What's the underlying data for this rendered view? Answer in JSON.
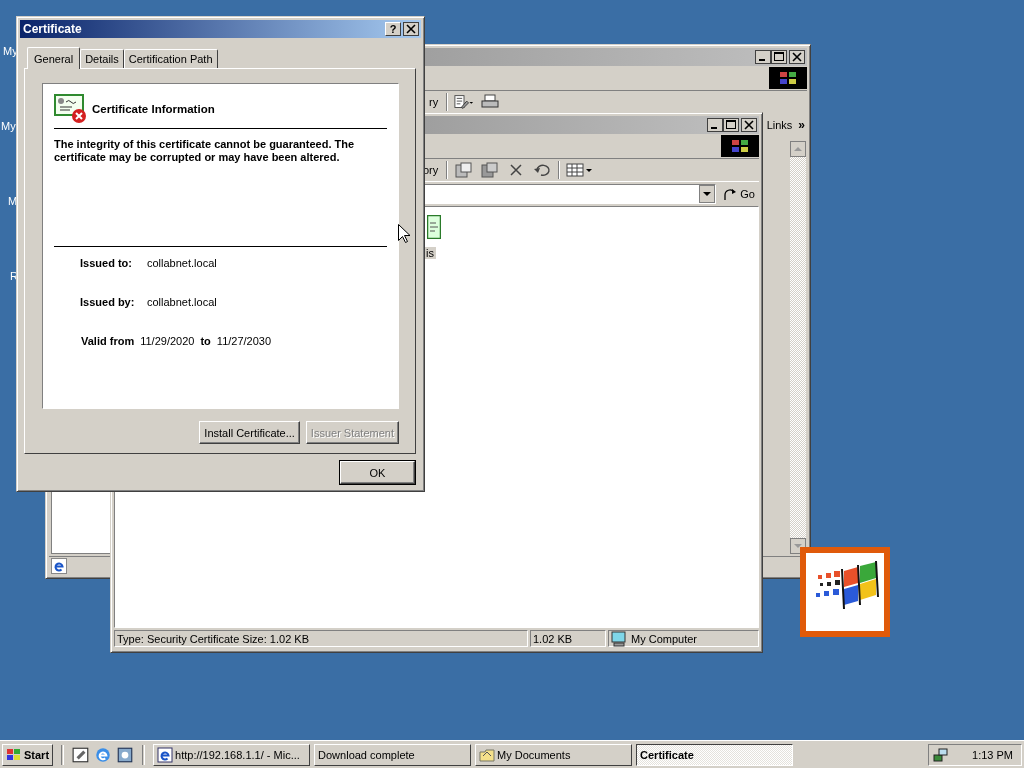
{
  "desktop": {
    "icons": [
      {
        "label": "My"
      },
      {
        "label": "My"
      },
      {
        "label": "M"
      },
      {
        "label": "R"
      }
    ]
  },
  "back_window": {
    "toolbar_fragment": "ry",
    "links": "Links",
    "chevron": "»"
  },
  "explorer_window": {
    "toolbar_fragment": "ory",
    "go": "Go",
    "file_label": "is",
    "status_bar": [
      "Type: Security Certificate Size: 1.02 KB",
      "1.02 KB",
      "My Computer"
    ]
  },
  "dialog": {
    "title": "Certificate",
    "help": "?",
    "tabs": [
      {
        "label": "General",
        "selected": true
      },
      {
        "label": "Details",
        "selected": false
      },
      {
        "label": "Certification Path",
        "selected": false
      }
    ],
    "heading": "Certificate Information",
    "message": "The integrity of this certificate cannot be guaranteed. The certificate may be corrupted or may have been altered.",
    "fields": [
      {
        "label": "Issued to:",
        "value": "collabnet.local"
      },
      {
        "label": "Issued by:",
        "value": "collabnet.local"
      }
    ],
    "validity": {
      "label": "Valid from",
      "from": "11/29/2020",
      "to_label": "to",
      "to": "11/27/2030"
    },
    "buttons": [
      {
        "label": "Install Certificate...",
        "disabled": false
      },
      {
        "label": "Issuer Statement",
        "disabled": true
      }
    ],
    "ok": "OK"
  },
  "taskbar": {
    "start": "Start",
    "tasks": [
      {
        "label": "http://192.168.1.1/ - Mic...",
        "kind": "browser",
        "selected": false
      },
      {
        "label": "Download complete",
        "kind": "plain",
        "selected": false
      },
      {
        "label": "My Documents",
        "kind": "folder",
        "selected": false
      },
      {
        "label": "Certificate",
        "kind": "plain",
        "selected": true
      }
    ],
    "clock": "1:13 PM"
  }
}
